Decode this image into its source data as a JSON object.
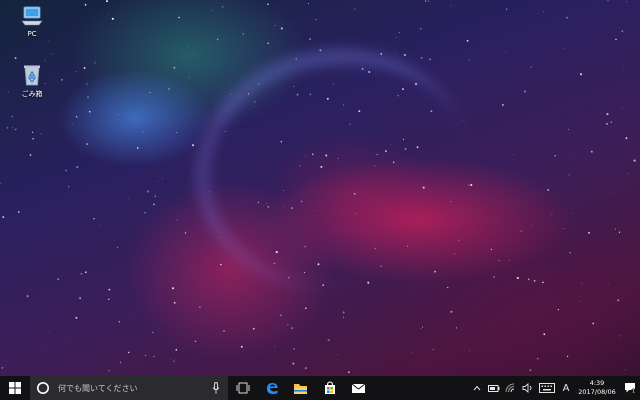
{
  "desktop": {
    "icons": [
      {
        "label": "PC",
        "icon": "computer-icon"
      },
      {
        "label": "ごみ箱",
        "icon": "recycle-bin-icon"
      }
    ]
  },
  "taskbar": {
    "search": {
      "placeholder": "何でも聞いてください"
    },
    "pinned_apps": [
      {
        "icon": "task-view-icon"
      },
      {
        "icon": "edge-icon"
      },
      {
        "icon": "file-explorer-icon"
      },
      {
        "icon": "store-icon"
      },
      {
        "icon": "mail-icon"
      }
    ],
    "tray": {
      "ime_mode": "A",
      "time": "4:39",
      "date": "2017/08/06",
      "notification_count": "1"
    }
  },
  "colors": {
    "taskbar_bg": "#121214",
    "search_bg": "#2b2b2f",
    "edge_blue": "#1e90ff",
    "explorer_yellow": "#f2c14e"
  }
}
